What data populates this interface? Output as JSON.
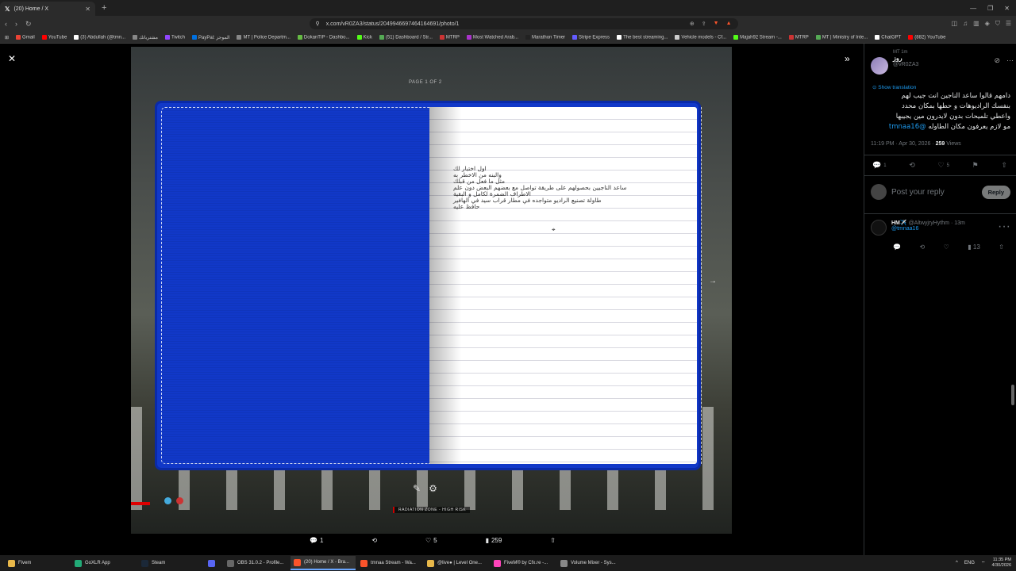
{
  "browser": {
    "tab_title": "(20) Home / X",
    "url": "x.com/vR0ZA3/status/2049946697464164691/photo/1",
    "bookmarks": [
      "Gmail",
      "YouTube",
      "(3) Abdullah (@tmn...",
      "مشترياتك",
      "Twitch",
      "PayPal: الموجز",
      "MT | Police Departm...",
      "DokanTIP - Dashbo...",
      "Kick",
      "(51) Dashboard / Str...",
      "MTRP",
      "Most Watched Arab...",
      "Marathon Timer",
      "Stripe Express",
      "The best streaming...",
      "Vehicle models - Cf...",
      "Majah92 Stream -...",
      "MTRP",
      "MT | Ministry of Inte...",
      "ChatGPT",
      "(882) YouTube"
    ]
  },
  "viewer": {
    "page_indicator": "PAGE 1 OF 2",
    "notebook_lines": [
      "اول اختبار لك",
      "والبنه من الاخطر به",
      "مثل ما فعل من قبلك",
      "ساعد الناجيين بحصولهم على طريقة تواصل مع بعضهم البعض دون علم",
      "الاطراف الضمرة لكامل و البقية",
      "طاولة تصنيع الراديو متواجده في مطار قراب سيد في الهافير",
      "حافظ عليه"
    ],
    "hud_zone": "RADIATION ZONE - HIGH RISK",
    "actions": {
      "replies": "1",
      "likes": "5",
      "views": "259"
    }
  },
  "tweet": {
    "retweet_context": "MT 1m",
    "author_name": "روز",
    "author_handle": "@vR0ZA3",
    "show_translation": "Show translation",
    "text_lines": [
      "دامهم قالوا ساعد الناجين انت جيب لهم",
      "بنفسك الراديوهات و حطها بمكان محدد",
      "واعطي تلميحات بدون لايدرون مين يجيبها",
      "مو لازم يعرفون مكان الطاوله"
    ],
    "mention": "@tmnaa16",
    "time": "11:19 PM · Apr 30, 2026 · ",
    "views": "259",
    "views_label": " Views",
    "counts": {
      "replies": "1",
      "likes": "5"
    },
    "reply_placeholder": "Post your reply",
    "reply_button": "Reply"
  },
  "comment": {
    "name": "HM✈️",
    "handle": "@AltwyjryHythm · 13m",
    "mention": "@tmnaa16",
    "views": "13"
  },
  "taskbar": {
    "items": [
      "Fivem",
      "GoXLR App",
      "Steam",
      "",
      "OBS 31.0.2 - Profile...",
      "(20) Home / X - Bra...",
      "tmnaa Stream - Wa...",
      "@live● | Level One...",
      "FiveM® by Cfx.re -...",
      "Volume Mixer - Sys..."
    ],
    "lang": "ENG",
    "time": "11:35 PM",
    "date": "4/30/2026"
  }
}
